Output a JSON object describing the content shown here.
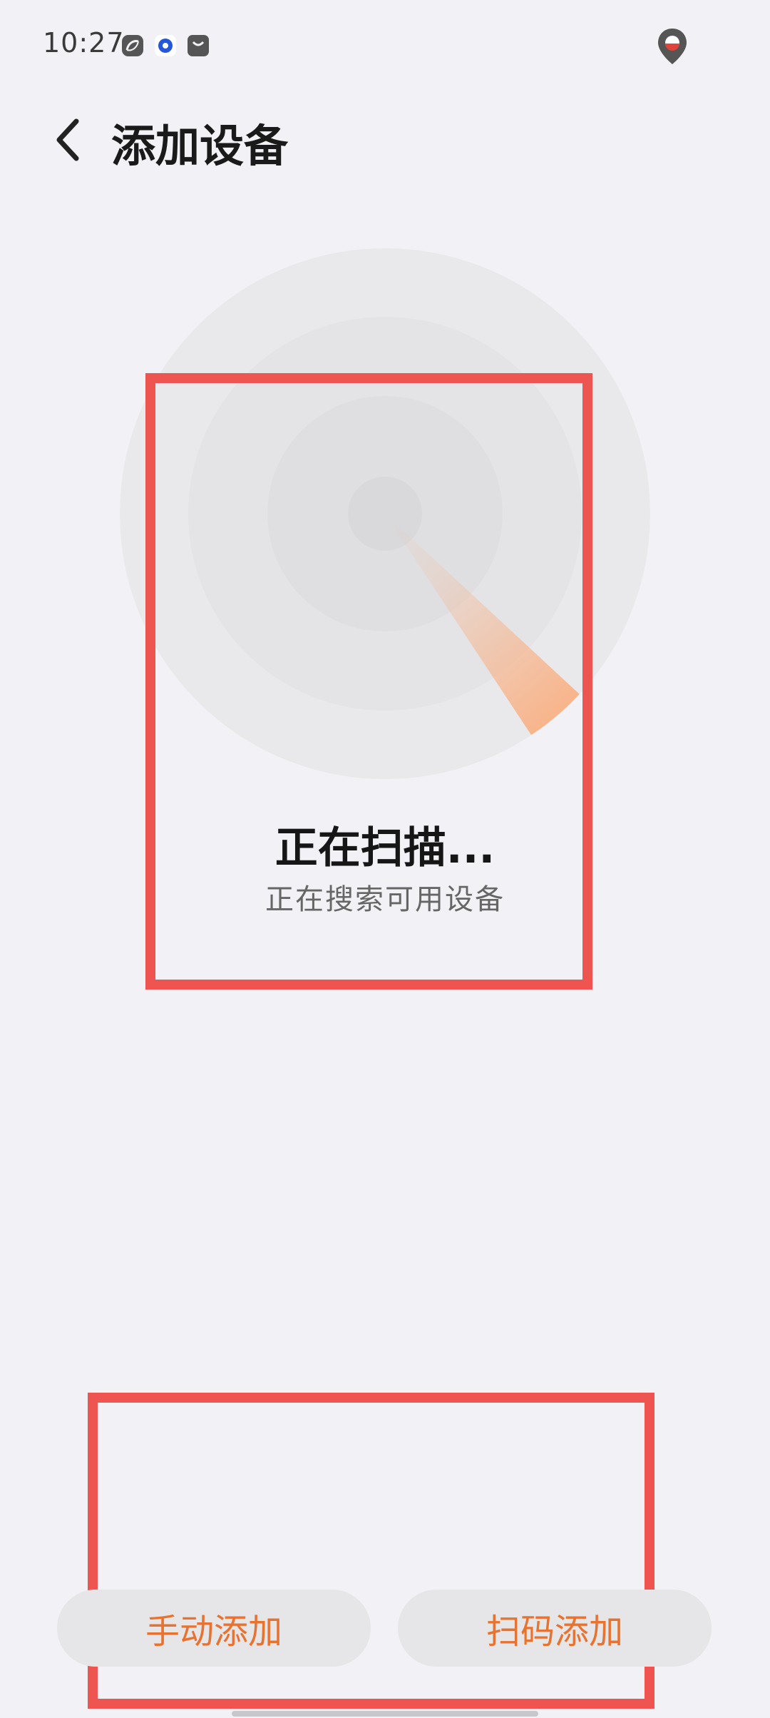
{
  "status_bar": {
    "time": "10:27",
    "icons": [
      "app-swirl-icon",
      "app-circle-icon",
      "shopping-bag-icon",
      "location-pin-icon"
    ]
  },
  "header": {
    "back_icon": "chevron-left-icon",
    "title": "添加设备"
  },
  "scan": {
    "title": "正在扫描...",
    "subtitle": "正在搜索可用设备"
  },
  "actions": {
    "manual_add": "手动添加",
    "scan_add": "扫码添加"
  },
  "colors": {
    "background": "#f2f2f6",
    "accent": "#e8722f",
    "highlight": "#ee5550",
    "button_bg": "#e6e6e8"
  }
}
